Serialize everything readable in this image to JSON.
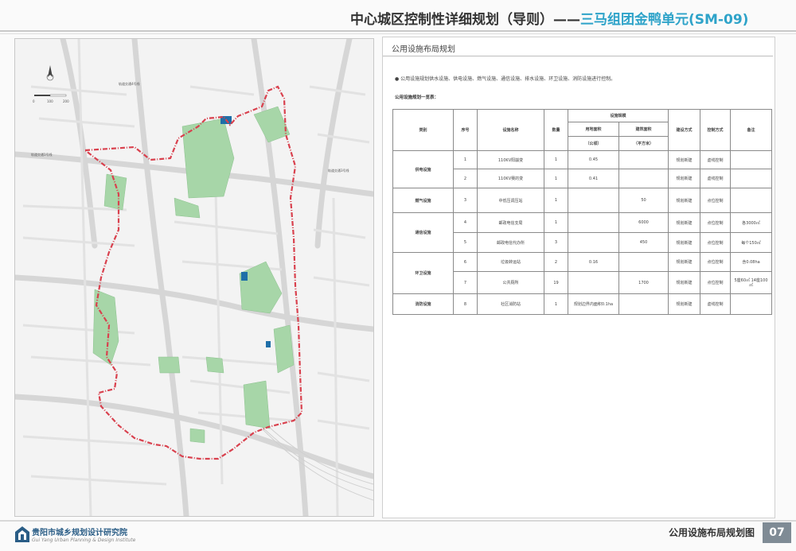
{
  "header": {
    "plan_title": "中心城区控制性详细规划（导则）",
    "separator": "——",
    "unit_title": "三马组团金鸭单元(SM-09)"
  },
  "panel": {
    "title": "公用设施布局规划",
    "note": "● 公用设施规划供水设施、供电设施、燃气设施、通信设施、排水设施、环卫设施、消防设施进行控制。",
    "table_caption": "公用设施规划一览表："
  },
  "table": {
    "headers": {
      "category": "类别",
      "number": "序号",
      "name": "设施名称",
      "quantity": "数量",
      "scale": "设施规模",
      "land_area": "用地面积",
      "floor_area": "建筑面积",
      "land_unit": "（公顷）",
      "floor_unit": "（平方米）",
      "construction": "建设方式",
      "control": "控制方式",
      "remarks": "备注"
    },
    "rows": [
      {
        "category": "供电设施",
        "number": "1",
        "name": "110KV阳崩变",
        "quantity": "1",
        "land_area": "0.45",
        "floor_area": "",
        "construction": "规划新建",
        "control": "虚线控制",
        "remarks": ""
      },
      {
        "category": "",
        "number": "2",
        "name": "110KV赛的变",
        "quantity": "1",
        "land_area": "0.41",
        "floor_area": "",
        "construction": "规划新建",
        "control": "虚线控制",
        "remarks": ""
      },
      {
        "category": "燃气设施",
        "number": "3",
        "name": "中低压调压站",
        "quantity": "1",
        "land_area": "",
        "floor_area": "50",
        "construction": "规划新建",
        "control": "点位控制",
        "remarks": ""
      },
      {
        "category": "通信设施",
        "number": "4",
        "name": "邮政电信支局",
        "quantity": "1",
        "land_area": "",
        "floor_area": "6000",
        "construction": "规划新建",
        "control": "点位控制",
        "remarks": "各3000㎡"
      },
      {
        "category": "",
        "number": "5",
        "name": "邮政电信代办所",
        "quantity": "3",
        "land_area": "",
        "floor_area": "450",
        "construction": "规划新建",
        "control": "点位控制",
        "remarks": "每个150㎡"
      },
      {
        "category": "环卫设施",
        "number": "6",
        "name": "垃圾转运站",
        "quantity": "2",
        "land_area": "0.16",
        "floor_area": "",
        "construction": "规划新建",
        "control": "点位控制",
        "remarks": "含0.08ha"
      },
      {
        "category": "",
        "number": "7",
        "name": "公共厕所",
        "quantity": "19",
        "land_area": "",
        "floor_area": "1700",
        "construction": "规划新建",
        "control": "点位控制",
        "remarks": "5座60㎡ 14座100㎡"
      },
      {
        "category": "消防设施",
        "number": "8",
        "name": "社区消防站",
        "quantity": "1",
        "land_area": "规划边界内面积0.1ha",
        "floor_area": "",
        "construction": "规划新建",
        "control": "虚线控制",
        "remarks": ""
      }
    ]
  },
  "map": {
    "scale_labels": [
      "0",
      "100",
      "200"
    ],
    "road_labels": [
      "轨道交通4号线",
      "轨道交通1号线",
      "轨道交通3号线"
    ]
  },
  "footer": {
    "org_name": "贵阳市城乡规划设计研究院",
    "org_name_en": "Gui Yang Urban Planning & Design Institute",
    "caption": "公用设施布局规划图",
    "page_number": "07"
  },
  "colors": {
    "accent": "#2ea3c9",
    "boundary": "#d9414e",
    "green_space": "#a7d6a8",
    "facility": "#1f6fa8",
    "page_badge": "#7f8b95"
  }
}
